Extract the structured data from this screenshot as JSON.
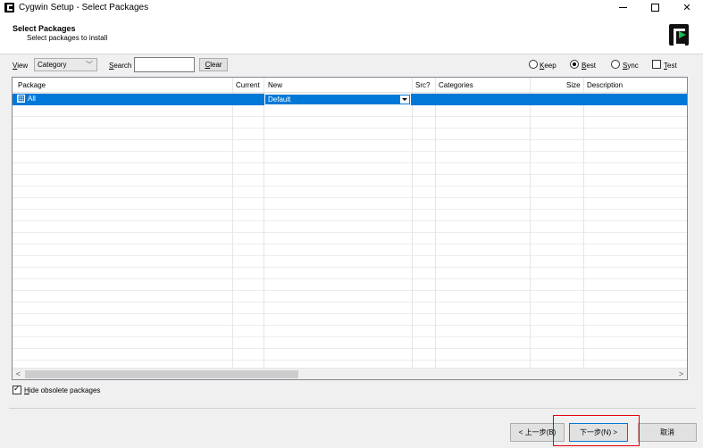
{
  "window": {
    "title": "Cygwin Setup - Select Packages",
    "minimize_glyph": "—",
    "maximize_glyph": "☐",
    "close_glyph": "✕"
  },
  "header": {
    "title": "Select Packages",
    "subtitle": "Select packages to install",
    "logo_icon": "cygwin-logo-icon"
  },
  "toolbar": {
    "view_label_mnemonic": "V",
    "view_label_rest": "iew",
    "view_value": "Category",
    "search_label_mnemonic": "S",
    "search_label_rest": "earch",
    "search_value": "",
    "clear_mnemonic": "C",
    "clear_rest": "lear",
    "radios": [
      {
        "mnemonic": "K",
        "rest": "eep",
        "checked": false
      },
      {
        "mnemonic": "B",
        "rest": "est",
        "checked": true
      },
      {
        "mnemonic": "S",
        "rest": "ync",
        "checked": false
      }
    ],
    "test_mnemonic": "T",
    "test_rest": "est",
    "test_checked": false
  },
  "grid": {
    "columns": [
      "Package",
      "Current",
      "New",
      "Src?",
      "Categories",
      "Size",
      "Description"
    ],
    "rows": [
      {
        "package": "All",
        "current": "",
        "new": "Default",
        "src": "",
        "categories": "",
        "size": "",
        "description": "",
        "selected": true,
        "expander": "⊞"
      }
    ],
    "scroll_left": "<",
    "scroll_right": ">"
  },
  "footer": {
    "hide_obsolete_mnemonic": "H",
    "hide_obsolete_rest": "ide obsolete packages",
    "hide_obsolete_checked": true,
    "back_label": "< 上一步(B)",
    "next_label": "下一步(N) >",
    "cancel_label": "取消"
  },
  "colors": {
    "selection": "#0078d7",
    "highlight_box": "#e3000b",
    "logo_accent": "#18c24b"
  }
}
